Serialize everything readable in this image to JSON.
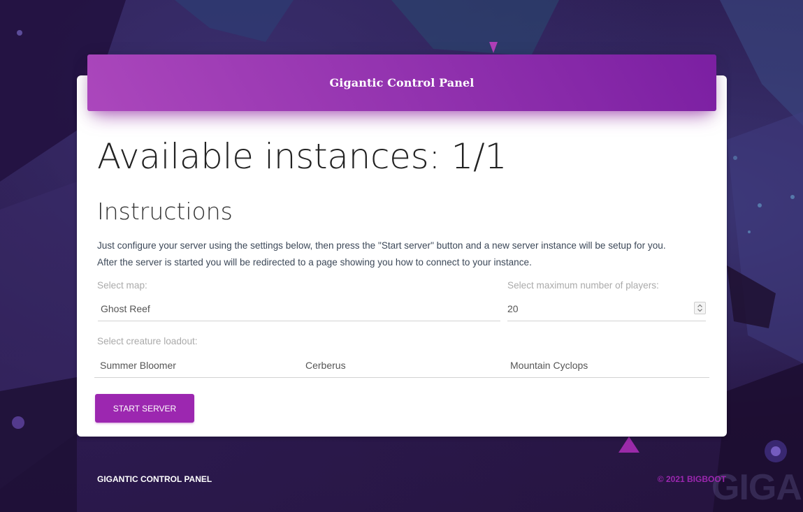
{
  "header": {
    "title": "Gigantic Control Panel"
  },
  "main": {
    "instances_title": "Available instances: 1/1",
    "instructions_heading": "Instructions",
    "instructions_lines": [
      "Just configure your server using the settings below, then press the \"Start server\" button and a new server instance will be setup for you.",
      "After the server is started you will be redirected to a page showing you how to connect to your instance."
    ]
  },
  "form": {
    "map_label": "Select map:",
    "map_value": "Ghost Reef",
    "players_label": "Select maximum number of players:",
    "players_value": "20",
    "creature_label": "Select creature loadout:",
    "creatures": [
      "Summer Bloomer",
      "Cerberus",
      "Mountain Cyclops"
    ],
    "start_button": "START SERVER"
  },
  "footer": {
    "left": "GIGANTIC CONTROL PANEL",
    "right": "© 2021 BIGBOOT"
  },
  "background": {
    "watermark_text": "GIGAN"
  },
  "colors": {
    "primary": "#9c27b0",
    "header_gradient_start": "#ab47bc",
    "header_gradient_end": "#7b1fa2",
    "background": "#2b1a4c"
  },
  "icons": {
    "stepper": "spin-up-down-icon"
  }
}
